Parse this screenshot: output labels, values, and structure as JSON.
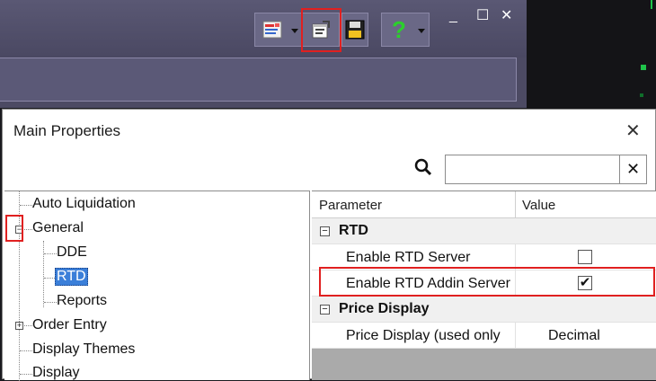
{
  "toolbar": {
    "buttons": [
      {
        "icon": "report-icon",
        "has_dropdown": true
      },
      {
        "icon": "properties-icon",
        "has_dropdown": false,
        "highlighted": true
      },
      {
        "icon": "save-icon",
        "has_dropdown": false
      },
      {
        "icon": "help-icon",
        "label": "?",
        "has_dropdown": true
      }
    ],
    "window_controls": {
      "minimize": "_",
      "maximize": "☐",
      "close": "✕"
    }
  },
  "dialog": {
    "title": "Main Properties",
    "close_label": "✕",
    "search": {
      "value": "",
      "placeholder": "",
      "clear_label": "✕"
    },
    "tree": {
      "items": [
        {
          "label": "Auto Liquidation"
        },
        {
          "label": "General",
          "expander": "−"
        },
        {
          "label": "DDE"
        },
        {
          "label": "RTD",
          "selected": true
        },
        {
          "label": "Reports"
        },
        {
          "label": "Order Entry",
          "expander": "+"
        },
        {
          "label": "Display Themes"
        },
        {
          "label": "Display"
        }
      ]
    },
    "grid": {
      "headers": {
        "parameter": "Parameter",
        "value": "Value"
      },
      "groups": [
        {
          "name": "RTD",
          "expander": "−",
          "rows": [
            {
              "name": "Enable RTD Server",
              "checked": false
            },
            {
              "name": "Enable RTD Addin Server",
              "checked": true,
              "highlighted": true
            }
          ]
        },
        {
          "name": "Price Display",
          "expander": "−",
          "rows": [
            {
              "name": "Price Display (used only",
              "value": "Decimal"
            }
          ]
        }
      ]
    }
  },
  "colors": {
    "highlight": "#e02020",
    "selection": "#3b7fd9",
    "background_window": "#4c4a63",
    "accent_green": "#1fc34a"
  }
}
